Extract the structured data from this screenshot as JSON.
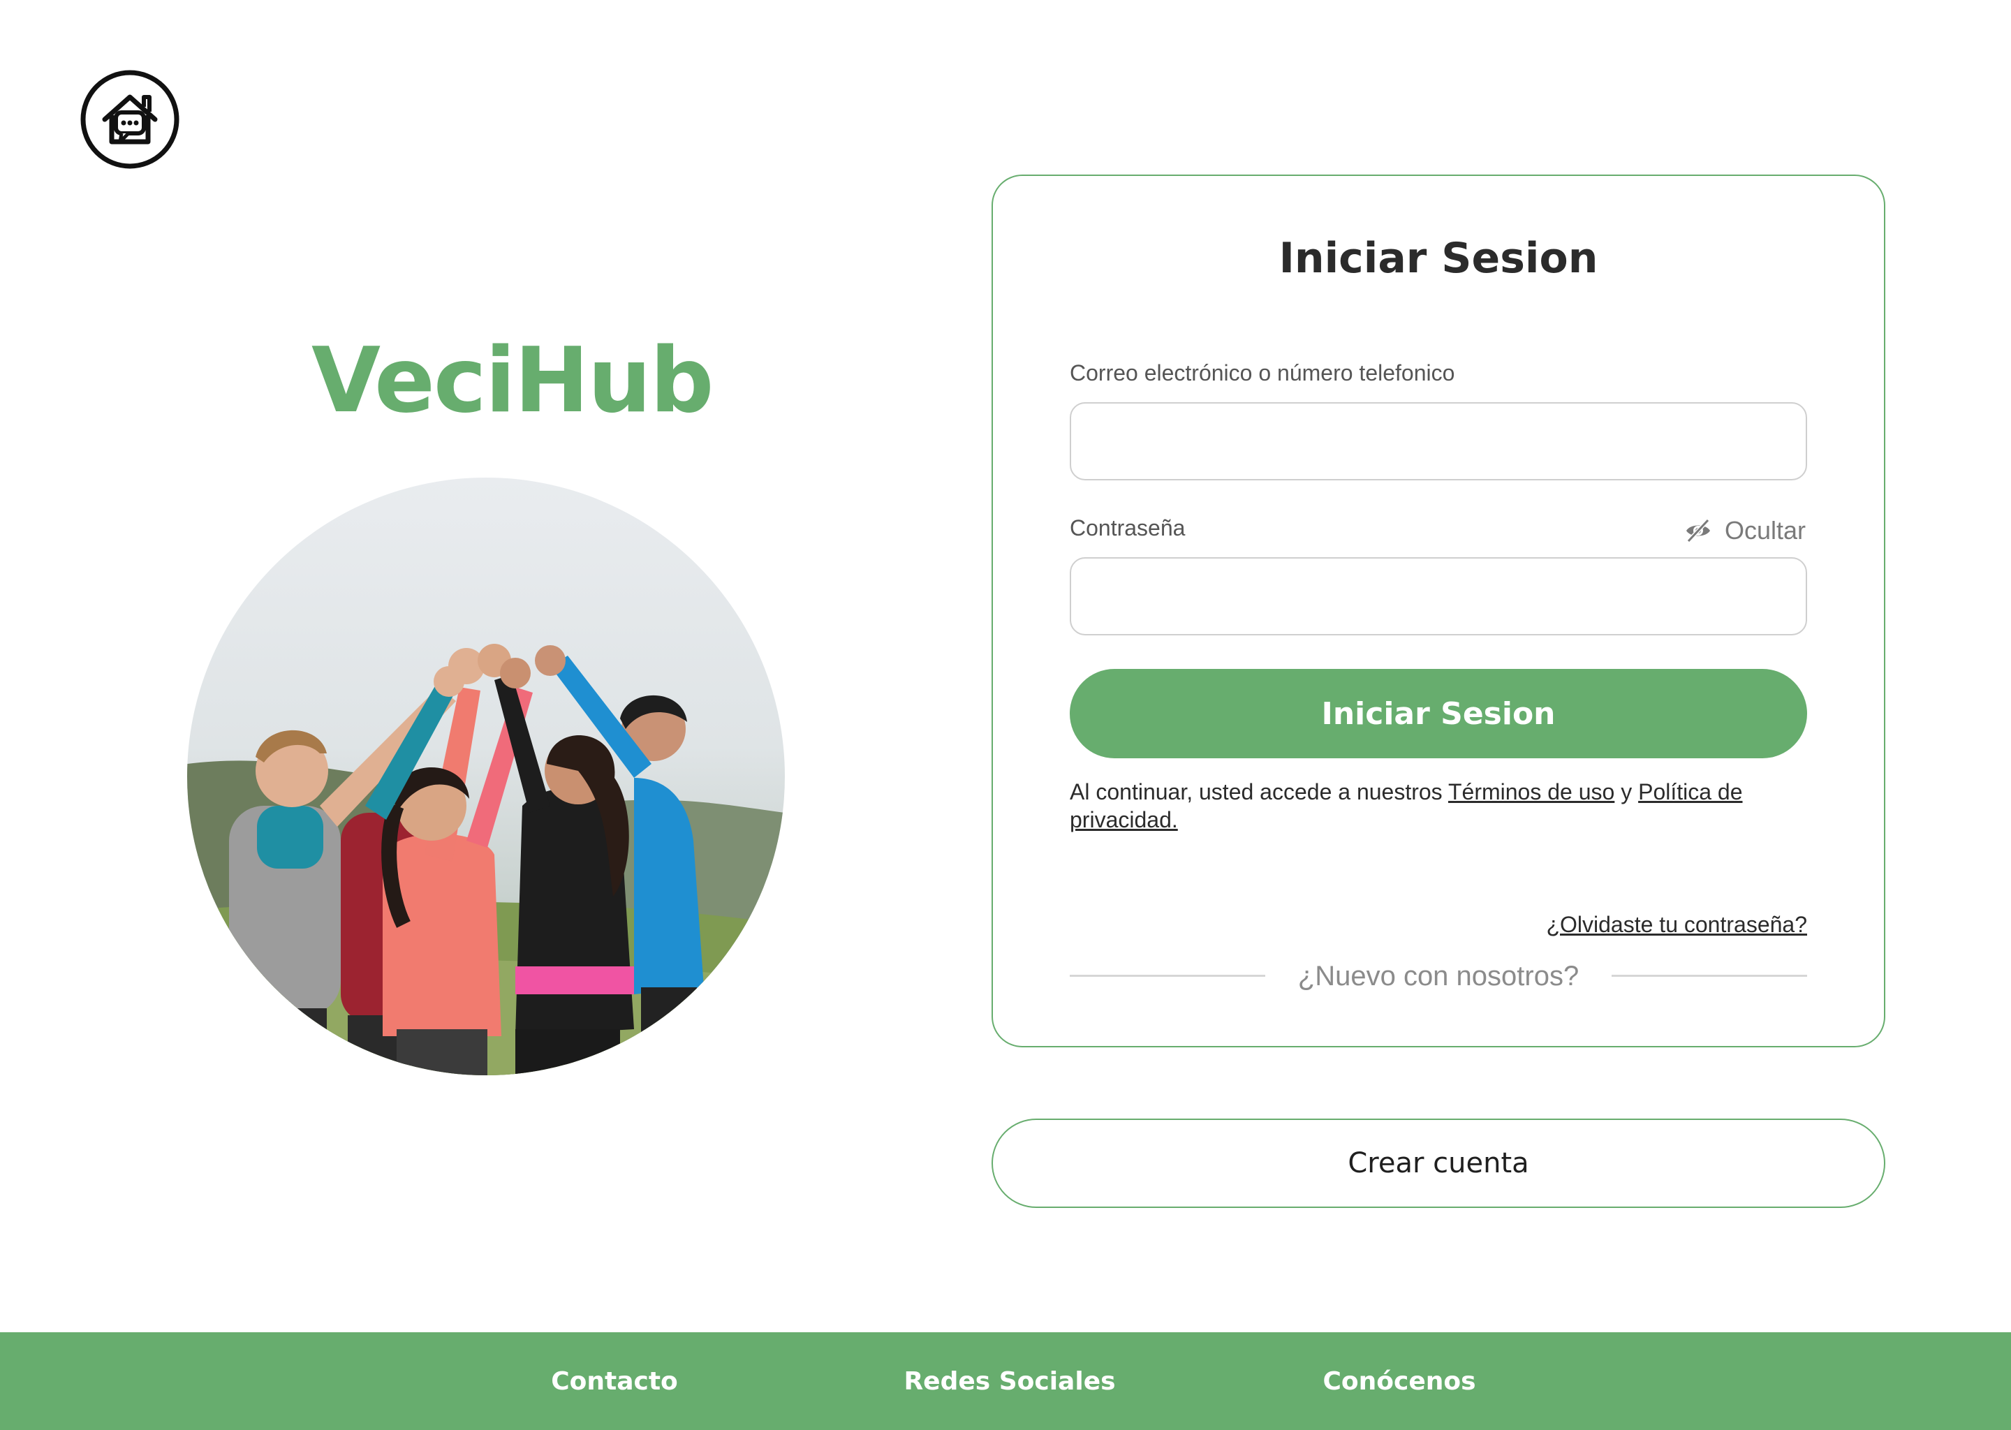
{
  "brand": {
    "name": "VeciHub",
    "color": "#67ad6e"
  },
  "logo": {
    "icon": "house-chat-icon"
  },
  "hero_image": {
    "icon": "group-high-five-photo"
  },
  "login": {
    "title": "Iniciar Sesion",
    "email_label": "Correo electrónico o número telefonico",
    "email_value": "",
    "password_label": "Contraseña",
    "password_value": "",
    "toggle_label": "Ocultar",
    "toggle_icon": "eye-off-icon",
    "submit_label": "Iniciar Sesion",
    "legal": {
      "prefix": "Al continuar, usted accede a nuestros ",
      "terms": "Términos de uso",
      "and": " y ",
      "privacy": "Política de privacidad."
    },
    "forgot": "¿Olvidaste tu contraseña?",
    "divider": "¿Nuevo con nosotros?"
  },
  "create_account": "Crear cuenta",
  "footer": {
    "links": [
      "Contacto",
      "Redes Sociales",
      "Conócenos"
    ]
  },
  "colors": {
    "accent": "#67ad6e",
    "text": "#2b2b2b",
    "muted": "#8b8b8b",
    "input_border": "#cfcfcf"
  }
}
